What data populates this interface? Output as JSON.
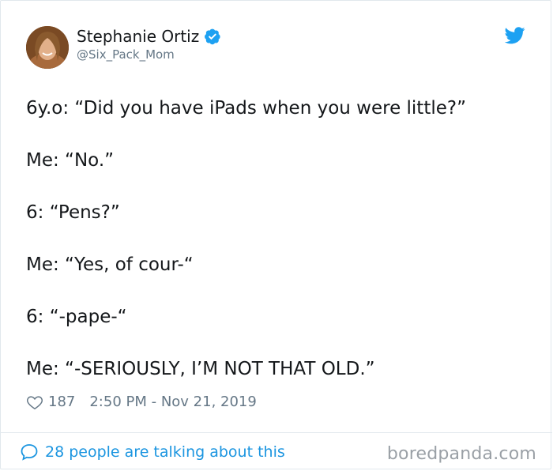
{
  "author": {
    "display_name": "Stephanie Ortiz",
    "handle": "@Six_Pack_Mom",
    "verified": true
  },
  "tweet": {
    "lines": [
      "6y.o: “Did you have iPads when you were little?”",
      "Me: “No.”",
      "6: “Pens?”",
      "Me: “Yes, of cour-“",
      "6: “-pape-“",
      "Me: “-SERIOUSLY, I’M NOT THAT OLD.”"
    ],
    "likes": "187",
    "timestamp": "2:50 PM - Nov 21, 2019"
  },
  "footer": {
    "conversation_text": "28 people are talking about this",
    "watermark": "boredpanda.com"
  },
  "colors": {
    "twitter_blue": "#1da1f2",
    "link_blue": "#1b95e0",
    "muted_gray": "#657786",
    "border": "#e1e8ed"
  },
  "icons": [
    "avatar",
    "verified-badge-icon",
    "twitter-bird-icon",
    "heart-icon",
    "speech-bubble-icon"
  ]
}
